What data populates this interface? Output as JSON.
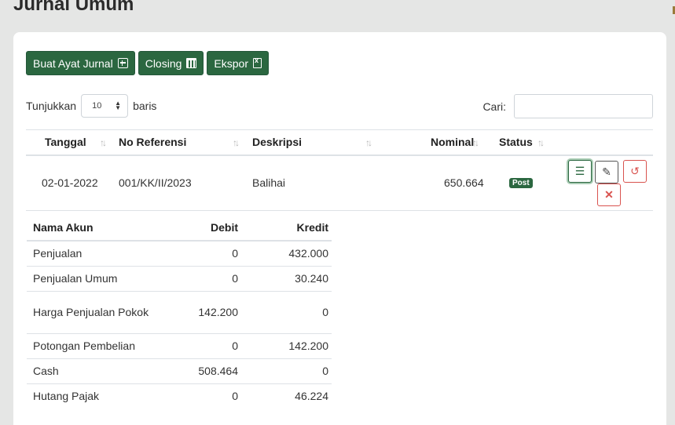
{
  "page": {
    "title": "Jurnal Umum"
  },
  "toolbar": {
    "buat_label": "Buat Ayat Jurnal",
    "closing_label": "Closing",
    "ekspor_label": "Ekspor"
  },
  "length_menu": {
    "prefix": "Tunjukkan",
    "value": "10",
    "suffix": "baris"
  },
  "search": {
    "label": "Cari:",
    "value": ""
  },
  "table": {
    "headers": {
      "tanggal": "Tanggal",
      "no_referensi": "No Referensi",
      "deskripsi": "Deskripsi",
      "nominal": "Nominal",
      "status": "Status"
    },
    "rows": [
      {
        "tanggal": "02-01-2022",
        "no_referensi": "001/KK/II/2023",
        "deskripsi": "Balihai",
        "nominal": "650.664",
        "status": "Post"
      }
    ]
  },
  "detail": {
    "headers": {
      "akun": "Nama Akun",
      "debit": "Debit",
      "kredit": "Kredit"
    },
    "rows": [
      {
        "akun": "Penjualan",
        "debit": "0",
        "kredit": "432.000"
      },
      {
        "akun": "Penjualan Umum",
        "debit": "0",
        "kredit": "30.240"
      },
      {
        "akun": "Harga Penjualan Pokok",
        "debit": "142.200",
        "kredit": "0"
      },
      {
        "akun": "Potongan Pembelian",
        "debit": "0",
        "kredit": "142.200"
      },
      {
        "akun": "Cash",
        "debit": "508.464",
        "kredit": "0"
      },
      {
        "akun": "Hutang Pajak",
        "debit": "0",
        "kredit": "46.224"
      }
    ]
  },
  "icons": {
    "add": "plus-square-icon",
    "closing": "calendar-icon",
    "export": "file-excel-icon",
    "detail": "list-icon",
    "edit": "edit-icon",
    "undo": "undo-icon",
    "delete": "close-icon"
  },
  "colors": {
    "primary": "#2b6740",
    "danger": "#d9534f",
    "background": "#e5e6e5"
  }
}
